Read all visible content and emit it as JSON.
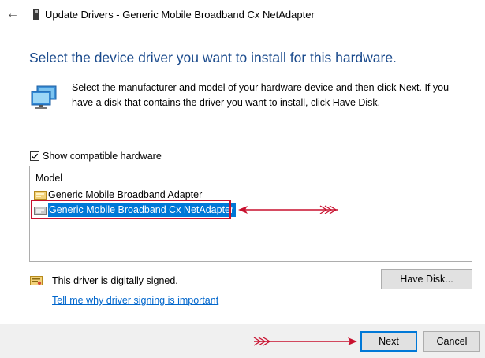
{
  "window": {
    "title": "Update Drivers - Generic Mobile Broadband Cx NetAdapter",
    "back_icon": "back-arrow-icon"
  },
  "heading": "Select the device driver you want to install for this hardware.",
  "instructions": "Select the manufacturer and model of your hardware device and then click Next. If you have a disk that contains the driver you want to install, click Have Disk.",
  "compatible_checkbox": {
    "label": "Show compatible hardware",
    "checked": true
  },
  "model_list": {
    "header": "Model",
    "items": [
      {
        "label": "Generic Mobile Broadband Adapter",
        "selected": false
      },
      {
        "label": "Generic Mobile Broadband Cx NetAdapter",
        "selected": true
      }
    ]
  },
  "signing": {
    "status": "This driver is digitally signed.",
    "link": "Tell me why driver signing is important"
  },
  "buttons": {
    "have_disk": "Have Disk...",
    "next": "Next",
    "cancel": "Cancel"
  },
  "colors": {
    "heading": "#1a4a8c",
    "selection": "#0078d7",
    "annotation": "#c8102e",
    "link": "#0066cc"
  }
}
